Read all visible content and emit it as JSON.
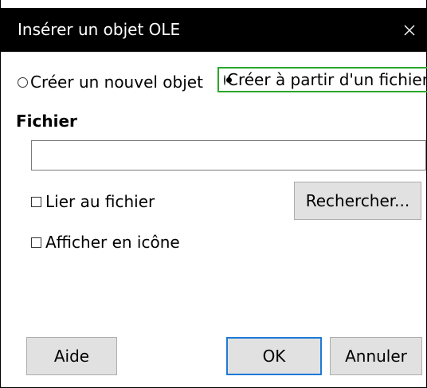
{
  "dialog": {
    "title": "Insérer un objet OLE"
  },
  "options": {
    "new_object_label": "Créer un nouvel objet",
    "from_file_label": "Créer à partir d'un fichier",
    "selected": "from_file"
  },
  "file": {
    "section_label": "Fichier",
    "path_value": "",
    "link_label": "Lier au fichier",
    "link_checked": false,
    "icon_label": "Afficher en icône",
    "icon_checked": false,
    "browse_label": "Rechercher..."
  },
  "buttons": {
    "help_label": "Aide",
    "ok_label": "OK",
    "cancel_label": "Annuler"
  },
  "icons": {
    "close": "close-icon"
  },
  "colors": {
    "titlebar": "#000000",
    "focus_outline": "#2aa62a",
    "default_button_border": "#1e7ad6"
  }
}
